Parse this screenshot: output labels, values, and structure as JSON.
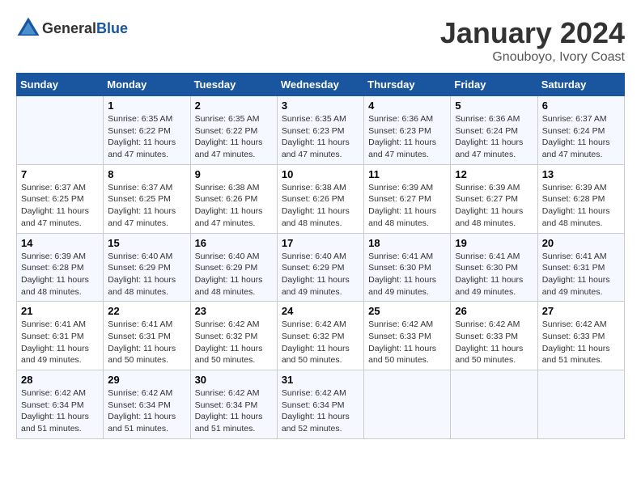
{
  "header": {
    "logo_general": "General",
    "logo_blue": "Blue",
    "month_title": "January 2024",
    "location": "Gnouboyo, Ivory Coast"
  },
  "calendar": {
    "days_of_week": [
      "Sunday",
      "Monday",
      "Tuesday",
      "Wednesday",
      "Thursday",
      "Friday",
      "Saturday"
    ],
    "weeks": [
      [
        {
          "day": "",
          "sunrise": "",
          "sunset": "",
          "daylight": ""
        },
        {
          "day": "1",
          "sunrise": "Sunrise: 6:35 AM",
          "sunset": "Sunset: 6:22 PM",
          "daylight": "Daylight: 11 hours and 47 minutes."
        },
        {
          "day": "2",
          "sunrise": "Sunrise: 6:35 AM",
          "sunset": "Sunset: 6:22 PM",
          "daylight": "Daylight: 11 hours and 47 minutes."
        },
        {
          "day": "3",
          "sunrise": "Sunrise: 6:35 AM",
          "sunset": "Sunset: 6:23 PM",
          "daylight": "Daylight: 11 hours and 47 minutes."
        },
        {
          "day": "4",
          "sunrise": "Sunrise: 6:36 AM",
          "sunset": "Sunset: 6:23 PM",
          "daylight": "Daylight: 11 hours and 47 minutes."
        },
        {
          "day": "5",
          "sunrise": "Sunrise: 6:36 AM",
          "sunset": "Sunset: 6:24 PM",
          "daylight": "Daylight: 11 hours and 47 minutes."
        },
        {
          "day": "6",
          "sunrise": "Sunrise: 6:37 AM",
          "sunset": "Sunset: 6:24 PM",
          "daylight": "Daylight: 11 hours and 47 minutes."
        }
      ],
      [
        {
          "day": "7",
          "sunrise": "Sunrise: 6:37 AM",
          "sunset": "Sunset: 6:25 PM",
          "daylight": "Daylight: 11 hours and 47 minutes."
        },
        {
          "day": "8",
          "sunrise": "Sunrise: 6:37 AM",
          "sunset": "Sunset: 6:25 PM",
          "daylight": "Daylight: 11 hours and 47 minutes."
        },
        {
          "day": "9",
          "sunrise": "Sunrise: 6:38 AM",
          "sunset": "Sunset: 6:26 PM",
          "daylight": "Daylight: 11 hours and 47 minutes."
        },
        {
          "day": "10",
          "sunrise": "Sunrise: 6:38 AM",
          "sunset": "Sunset: 6:26 PM",
          "daylight": "Daylight: 11 hours and 48 minutes."
        },
        {
          "day": "11",
          "sunrise": "Sunrise: 6:39 AM",
          "sunset": "Sunset: 6:27 PM",
          "daylight": "Daylight: 11 hours and 48 minutes."
        },
        {
          "day": "12",
          "sunrise": "Sunrise: 6:39 AM",
          "sunset": "Sunset: 6:27 PM",
          "daylight": "Daylight: 11 hours and 48 minutes."
        },
        {
          "day": "13",
          "sunrise": "Sunrise: 6:39 AM",
          "sunset": "Sunset: 6:28 PM",
          "daylight": "Daylight: 11 hours and 48 minutes."
        }
      ],
      [
        {
          "day": "14",
          "sunrise": "Sunrise: 6:39 AM",
          "sunset": "Sunset: 6:28 PM",
          "daylight": "Daylight: 11 hours and 48 minutes."
        },
        {
          "day": "15",
          "sunrise": "Sunrise: 6:40 AM",
          "sunset": "Sunset: 6:29 PM",
          "daylight": "Daylight: 11 hours and 48 minutes."
        },
        {
          "day": "16",
          "sunrise": "Sunrise: 6:40 AM",
          "sunset": "Sunset: 6:29 PM",
          "daylight": "Daylight: 11 hours and 48 minutes."
        },
        {
          "day": "17",
          "sunrise": "Sunrise: 6:40 AM",
          "sunset": "Sunset: 6:29 PM",
          "daylight": "Daylight: 11 hours and 49 minutes."
        },
        {
          "day": "18",
          "sunrise": "Sunrise: 6:41 AM",
          "sunset": "Sunset: 6:30 PM",
          "daylight": "Daylight: 11 hours and 49 minutes."
        },
        {
          "day": "19",
          "sunrise": "Sunrise: 6:41 AM",
          "sunset": "Sunset: 6:30 PM",
          "daylight": "Daylight: 11 hours and 49 minutes."
        },
        {
          "day": "20",
          "sunrise": "Sunrise: 6:41 AM",
          "sunset": "Sunset: 6:31 PM",
          "daylight": "Daylight: 11 hours and 49 minutes."
        }
      ],
      [
        {
          "day": "21",
          "sunrise": "Sunrise: 6:41 AM",
          "sunset": "Sunset: 6:31 PM",
          "daylight": "Daylight: 11 hours and 49 minutes."
        },
        {
          "day": "22",
          "sunrise": "Sunrise: 6:41 AM",
          "sunset": "Sunset: 6:31 PM",
          "daylight": "Daylight: 11 hours and 50 minutes."
        },
        {
          "day": "23",
          "sunrise": "Sunrise: 6:42 AM",
          "sunset": "Sunset: 6:32 PM",
          "daylight": "Daylight: 11 hours and 50 minutes."
        },
        {
          "day": "24",
          "sunrise": "Sunrise: 6:42 AM",
          "sunset": "Sunset: 6:32 PM",
          "daylight": "Daylight: 11 hours and 50 minutes."
        },
        {
          "day": "25",
          "sunrise": "Sunrise: 6:42 AM",
          "sunset": "Sunset: 6:33 PM",
          "daylight": "Daylight: 11 hours and 50 minutes."
        },
        {
          "day": "26",
          "sunrise": "Sunrise: 6:42 AM",
          "sunset": "Sunset: 6:33 PM",
          "daylight": "Daylight: 11 hours and 50 minutes."
        },
        {
          "day": "27",
          "sunrise": "Sunrise: 6:42 AM",
          "sunset": "Sunset: 6:33 PM",
          "daylight": "Daylight: 11 hours and 51 minutes."
        }
      ],
      [
        {
          "day": "28",
          "sunrise": "Sunrise: 6:42 AM",
          "sunset": "Sunset: 6:34 PM",
          "daylight": "Daylight: 11 hours and 51 minutes."
        },
        {
          "day": "29",
          "sunrise": "Sunrise: 6:42 AM",
          "sunset": "Sunset: 6:34 PM",
          "daylight": "Daylight: 11 hours and 51 minutes."
        },
        {
          "day": "30",
          "sunrise": "Sunrise: 6:42 AM",
          "sunset": "Sunset: 6:34 PM",
          "daylight": "Daylight: 11 hours and 51 minutes."
        },
        {
          "day": "31",
          "sunrise": "Sunrise: 6:42 AM",
          "sunset": "Sunset: 6:34 PM",
          "daylight": "Daylight: 11 hours and 52 minutes."
        },
        {
          "day": "",
          "sunrise": "",
          "sunset": "",
          "daylight": ""
        },
        {
          "day": "",
          "sunrise": "",
          "sunset": "",
          "daylight": ""
        },
        {
          "day": "",
          "sunrise": "",
          "sunset": "",
          "daylight": ""
        }
      ]
    ]
  }
}
